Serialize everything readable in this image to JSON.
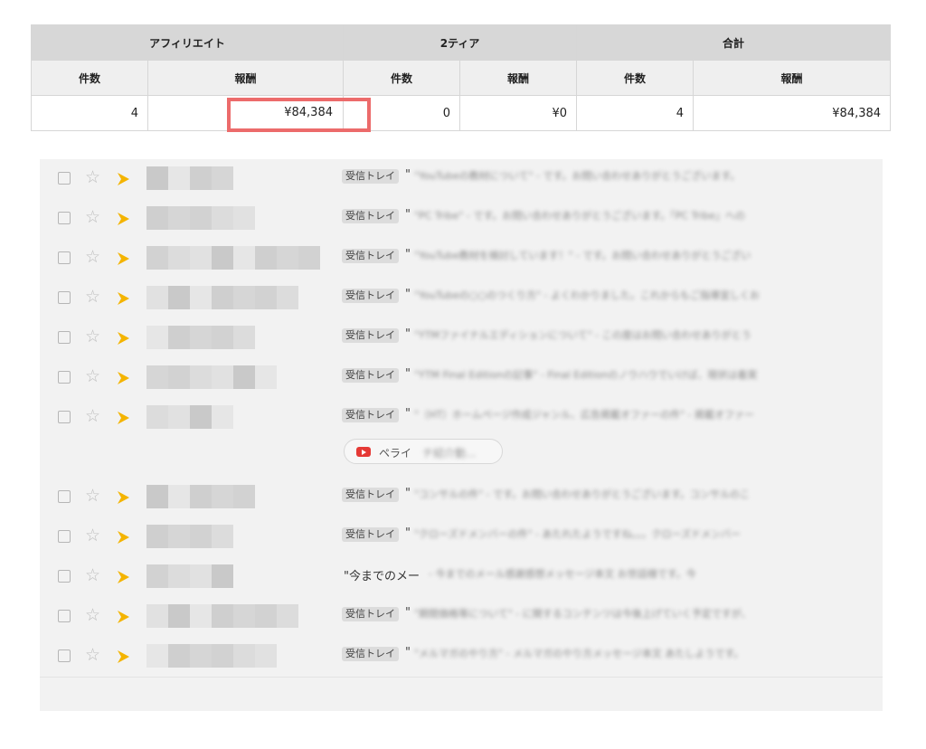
{
  "stats": {
    "groups": [
      "アフィリエイト",
      "2ティア",
      "合計"
    ],
    "subheaders": [
      "件数",
      "報酬",
      "件数",
      "報酬",
      "件数",
      "報酬"
    ],
    "values": [
      "4",
      "¥84,384",
      "0",
      "¥0",
      "4",
      "¥84,384"
    ],
    "highlight_color": "#ec6b6b"
  },
  "mail": {
    "label_text": "受信トレイ",
    "rows": [
      {
        "label": "受信トレイ",
        "subject": "\"YouTubeの教材について\" - です。お問い合わせありがとうございます。"
      },
      {
        "label": "受信トレイ",
        "subject": "\"PC Tribe\" - です。お問い合わせありがとうございます。「PC Tribe」への"
      },
      {
        "label": "受信トレイ",
        "subject": "\"YouTube教材を検討しています！\" - です。お問い合わせありがとうござい"
      },
      {
        "label": "受信トレイ",
        "subject": "\"YouTubeの○○のつくり方\" - よくわかりました。これからもご指導宜しくお"
      },
      {
        "label": "受信トレイ",
        "subject": "\"YTMファイナルエディションについて\" - この度はお問い合わせありがとう"
      },
      {
        "label": "受信トレイ",
        "subject": "\"YTM Final Editionの記事\" - Final Editionのノウハウでいけば、現状は着実"
      },
      {
        "label": "受信トレイ",
        "subject": "\"（HT）ホームページ作成ジャンル、広告掲載オファーの件\" - 掲載オファー"
      },
      {
        "label": "受信トレイ",
        "subject": "\"コンサルの件\" - です。お問い合わせありがとうございます。コンサルのこ"
      },
      {
        "label": "受信トレイ",
        "subject": "\"クローズドメンバーの件\" - あたれたようですね。。。クローズドメンバー"
      },
      {
        "label": "",
        "subject": "- 今までのメール感謝感想メッセージ本文 お世話様です。今"
      },
      {
        "label": "受信トレイ",
        "subject": "\"期間価格等について\" - に関するコンテンツは今後上げていく予定ですが、"
      },
      {
        "label": "受信トレイ",
        "subject": "\"メルマガのやり方\" - メルマガのやり方メッセージ本文 あたしようです。"
      }
    ],
    "plain_row_text": "\"今までのメー",
    "chip": {
      "label": "ペライ",
      "rest": "チ紹介動..."
    },
    "star_glyph": "☆",
    "important_color": "#f4b400"
  }
}
